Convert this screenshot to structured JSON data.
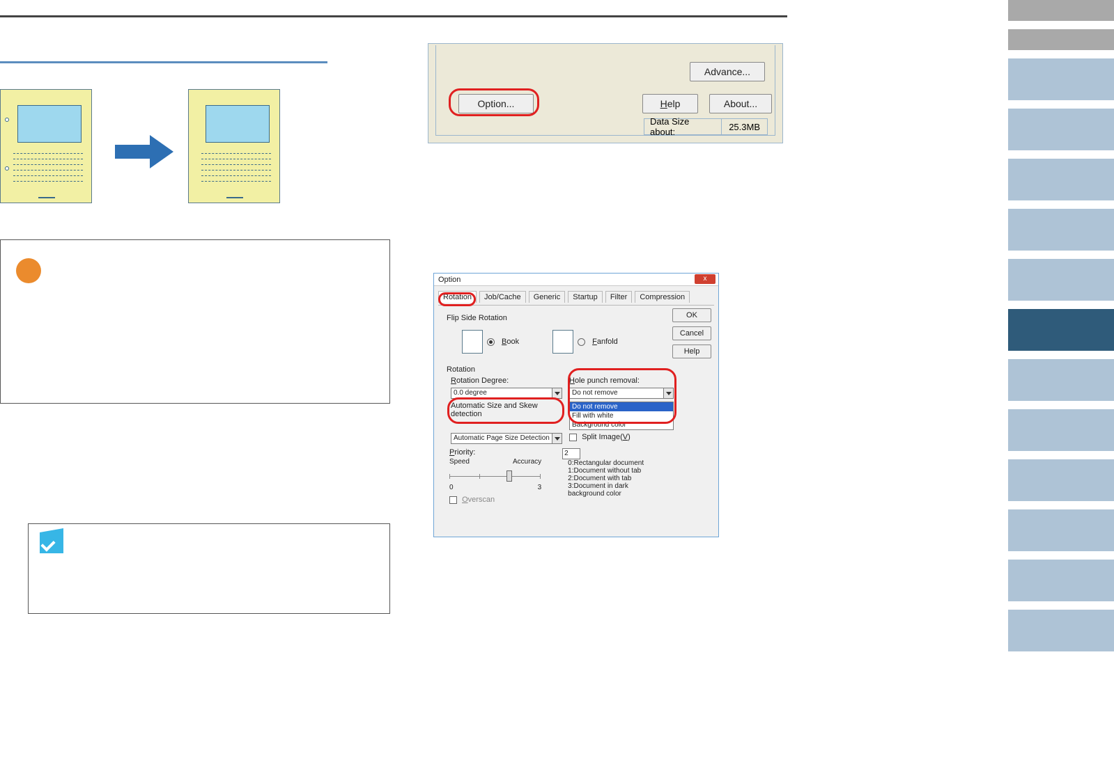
{
  "strip": {
    "advance": "Advance...",
    "option": "Option...",
    "help_hotkey": "H",
    "help_rest": "elp",
    "about": "About...",
    "datasize_label": "Data Size about:",
    "datasize_value": "25.3MB"
  },
  "dialog": {
    "title": "Option",
    "close_glyph": "x",
    "tabs": {
      "rotation": "Rotation",
      "jobcache": "Job/Cache",
      "generic": "Generic",
      "startup": "Startup",
      "filter": "Filter",
      "compression": "Compression"
    },
    "buttons": {
      "ok": "OK",
      "cancel": "Cancel",
      "help": "Help"
    },
    "flip": {
      "group": "Flip Side Rotation",
      "book_hotkey": "B",
      "book_rest": "ook",
      "fanfold_hotkey": "F",
      "fanfold_rest": "anfold"
    },
    "rotation": {
      "group": "Rotation",
      "degree_hotkey": "R",
      "degree_rest": "otation Degree:",
      "degree_value": "0.0 degree",
      "auto_label": "Automatic Size and Skew detection",
      "auto_value": "Automatic Page Size Detection",
      "hole_hotkey": "H",
      "hole_rest": "ole punch removal:",
      "hole_value": "Do not remove",
      "hole_options": {
        "o0": "Do not remove",
        "o1": "Fill with white",
        "o2": "Background color"
      },
      "split_hotkey": "V",
      "split_label": "Split Image(",
      "split_close": ")"
    },
    "priority": {
      "hotkey": "P",
      "rest": "riority:",
      "speed": "Speed",
      "accuracy": "Accuracy",
      "min": "0",
      "max": "3",
      "value": "2",
      "legend0": "0:Rectangular document",
      "legend1": "1:Document without tab",
      "legend2": "2:Document with tab",
      "legend3": "3:Document in dark background color"
    },
    "overscan": {
      "hotkey": "O",
      "rest": "verscan"
    }
  }
}
